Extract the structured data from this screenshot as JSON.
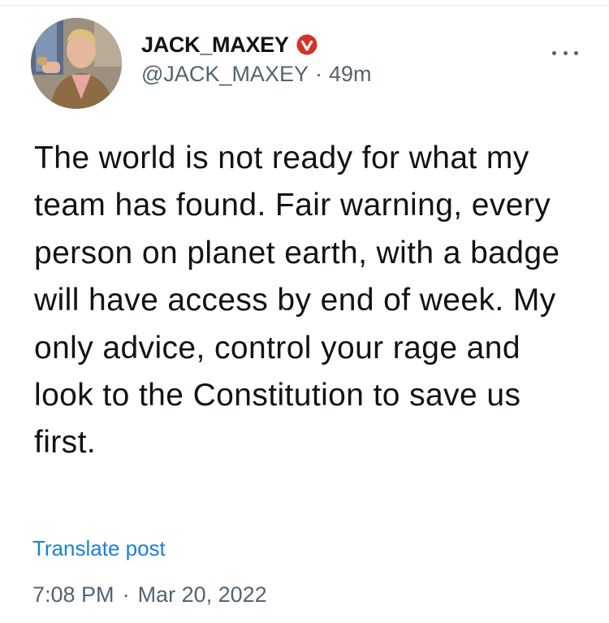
{
  "author": {
    "display_name": "JACK_MAXEY",
    "handle": "@JACK_MAXEY",
    "separator": "·",
    "relative_time": "49m",
    "verified_badge_color": "#d6322b",
    "verified_icon": "verified-check-icon"
  },
  "menu": {
    "icon": "more-options-icon"
  },
  "post": {
    "text": "The world is not ready for what my team has found. Fair warning, every person on planet earth, with a badge will have access by end of week. My only advice, control your rage and look to the Constitution to save us first."
  },
  "translate_label": "Translate post",
  "timestamp": {
    "time": "7:08 PM",
    "separator": "·",
    "date": "Mar 20, 2022"
  },
  "colors": {
    "text": "#0f1419",
    "secondary": "#536471",
    "link": "#1d7fd8"
  }
}
